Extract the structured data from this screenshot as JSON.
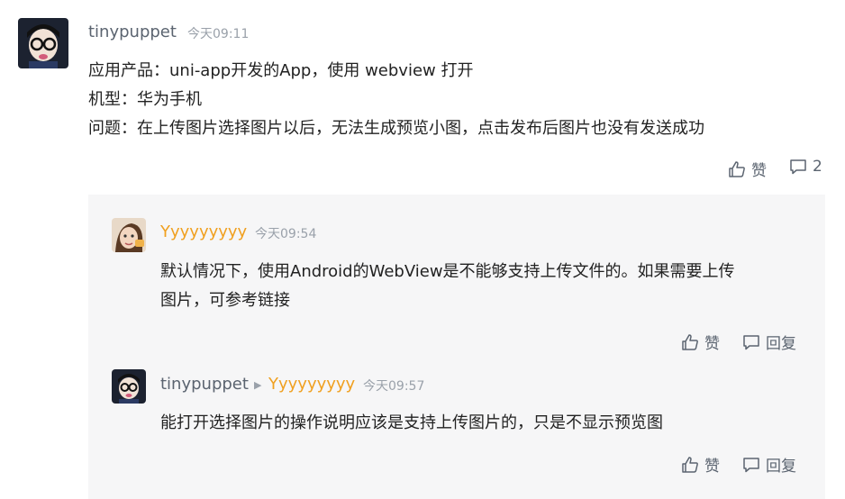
{
  "comment": {
    "author": "tinypuppet",
    "time": "今天09:11",
    "lines": [
      "应用产品：uni-app开发的App，使用 webview 打开",
      "机型：华为手机",
      "问题：在上传图片选择图片以后，无法生成预览小图，点击发布后图片也没有发送成功"
    ],
    "like_label": "赞",
    "comment_count": "2"
  },
  "replies": [
    {
      "author": "Yyyyyyyyy",
      "time": "今天09:54",
      "lines": [
        "默认情况下，使用Android的WebView是不能够支持上传文件的。如果需要上传",
        "图片，可参考链接"
      ],
      "like_label": "赞",
      "reply_label": "回复"
    },
    {
      "author": "tinypuppet",
      "reply_to": "Yyyyyyyyy",
      "time": "今天09:57",
      "lines": [
        "能打开选择图片的操作说明应该是支持上传图片的，只是不显示预览图"
      ],
      "like_label": "赞",
      "reply_label": "回复"
    }
  ],
  "icons": {
    "like": "thumbs-up-icon",
    "comment": "speech-bubble-icon"
  }
}
